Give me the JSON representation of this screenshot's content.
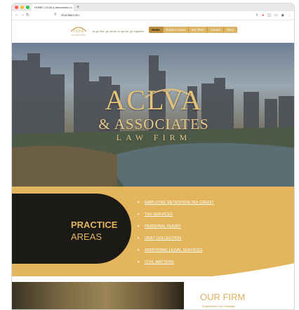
{
  "browser": {
    "tab_title": "HOME | CLVA & Associates L...",
    "tab_close": "×",
    "new_tab": "+",
    "url": "clva-law.com",
    "nav": {
      "back": "←",
      "forward": "→",
      "reload": "↻"
    }
  },
  "header": {
    "tagline": "to go fast, go alone; to go far, go together",
    "menu": [
      {
        "label": "Home",
        "active": true
      },
      {
        "label": "Practice Areas",
        "active": false
      },
      {
        "label": "Our Team",
        "active": false
      },
      {
        "label": "Contact",
        "active": false
      },
      {
        "label": "More",
        "active": false
      }
    ]
  },
  "hero": {
    "logo_main": "ACLVA",
    "logo_sub": "& ASSOCIATES",
    "logo_tag": "LAW FIRM"
  },
  "practice": {
    "title_line1": "PRACTICE",
    "title_line2": "AREAS",
    "items": [
      "EMPLOYEE RETENTION TAX CREDIT",
      "TAX SERVICES",
      "PERSONAL INJURY",
      "DEBT COLLECTION",
      "ADDITIONAL LEGAL SERVICES",
      "CIVIL MATTERS"
    ]
  },
  "firm": {
    "title": "OUR FIRM",
    "subtitle": "Experienced and Strategic"
  },
  "colors": {
    "gold": "#e3b65e",
    "dark": "#1c1a17",
    "menu_gold": "#dcb566"
  }
}
